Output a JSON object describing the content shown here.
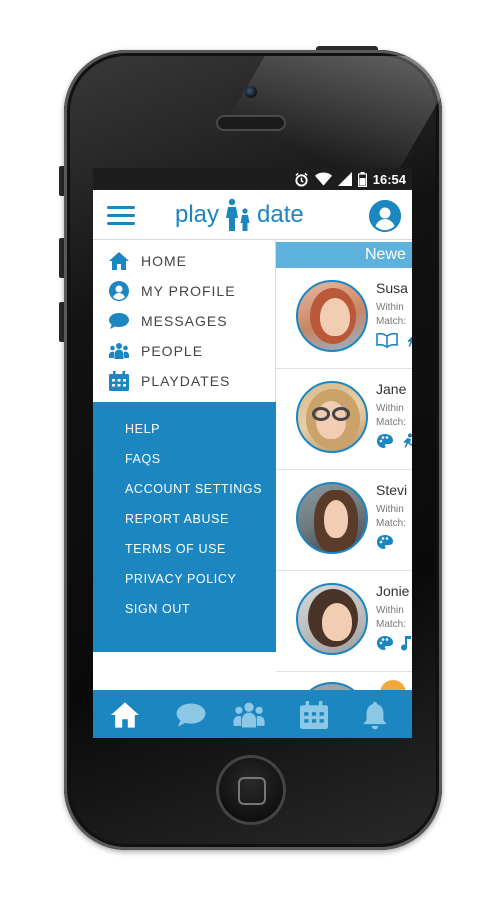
{
  "status_bar": {
    "time": "16:54"
  },
  "app": {
    "logo_text_left": "play",
    "logo_text_right": "date"
  },
  "drawer": {
    "primary_items": [
      {
        "label": "HOME",
        "icon": "home-icon"
      },
      {
        "label": "MY PROFILE",
        "icon": "user-circle-icon"
      },
      {
        "label": "MESSAGES",
        "icon": "chat-bubble-icon"
      },
      {
        "label": "PEOPLE",
        "icon": "people-icon"
      },
      {
        "label": "PLAYDATES",
        "icon": "calendar-icon"
      }
    ],
    "secondary_items": [
      {
        "label": "HELP"
      },
      {
        "label": "FAQS"
      },
      {
        "label": "ACCOUNT SETTINGS"
      },
      {
        "label": "REPORT ABUSE"
      },
      {
        "label": "TERMS OF USE"
      },
      {
        "label": "PRIVACY POLICY"
      },
      {
        "label": "SIGN OUT"
      }
    ]
  },
  "feed": {
    "header": "Newe",
    "cards": [
      {
        "name": "Susa",
        "meta1": "Within",
        "meta2": "Match:",
        "icons": [
          "book-icon",
          "runner-icon"
        ]
      },
      {
        "name": "Jane",
        "meta1": "Within",
        "meta2": "Match:",
        "icons": [
          "palette-icon",
          "runner-icon"
        ]
      },
      {
        "name": "Stevi",
        "meta1": "Within",
        "meta2": "Match:",
        "icons": [
          "palette-icon"
        ]
      },
      {
        "name": "Jonie",
        "meta1": "Within",
        "meta2": "Match:",
        "icons": [
          "palette-icon",
          "music-note-icon"
        ]
      }
    ]
  },
  "tabbar": {
    "tabs": [
      "home-icon",
      "chat-bubble-icon",
      "people-icon",
      "calendar-icon",
      "bell-icon"
    ]
  },
  "colors": {
    "brand_blue": "#1b86c0",
    "header_blue": "#5cb2dc",
    "status_bar": "#1d1d1d"
  }
}
